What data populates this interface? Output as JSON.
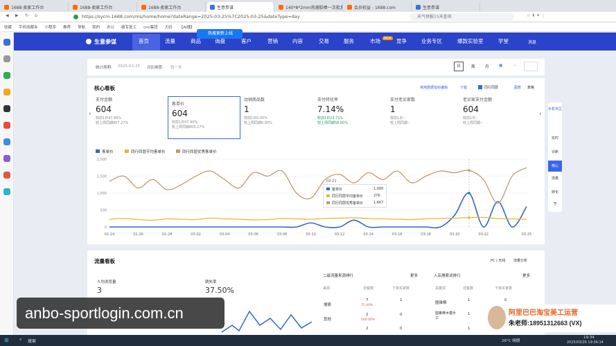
{
  "browser": {
    "tabs": [
      {
        "label": "1688-卖家工作台",
        "active": false
      },
      {
        "label": "1688-卖家工作台",
        "active": false
      },
      {
        "label": "1688-卖家工作台",
        "active": false
      },
      {
        "label": "生意参谋",
        "active": true
      },
      {
        "label": "140*8*2mm热熔胶棒一次批发",
        "active": false
      },
      {
        "label": "会员权益 - 1688.com",
        "active": false
      },
      {
        "label": "生意参谋",
        "active": false
      }
    ],
    "url": "https://sycm.1688.com/ms/home/home?dateRange=2025-03-25%7C2025-03-25&dateType=day",
    "search_placeholder": "天气预报15天查询",
    "bookmarks": [
      "收藏",
      "手机收藏夹",
      "小程序",
      "推荐",
      "导航",
      "我的",
      "办公",
      "破军复工",
      "cnc集团",
      "大码",
      "【AI播】"
    ]
  },
  "app": {
    "brand": "生意参谋",
    "hot_tag": "热搜更新上线",
    "nav": [
      "首页",
      "流量",
      "商品",
      "询盘",
      "客户",
      "营销",
      "内容",
      "交易",
      "服务",
      "市场",
      "竞争",
      "业务专区",
      "爆款实验室",
      "学堂",
      "消息"
    ],
    "market_badge": "NEW"
  },
  "period": {
    "stat_label": "统计周期:",
    "stat_value": "2025-03-25",
    "compare_label": "对比维度:",
    "compare_value": "较一天",
    "buttons": [
      "日",
      "周",
      "月"
    ]
  },
  "core": {
    "title": "核心看板",
    "links": [
      "常用数据指标编辑",
      "下载",
      "同行同层",
      "图表",
      "表格"
    ],
    "metrics": [
      {
        "label": "支付金额",
        "value": "604",
        "sub1": "较前1日47.90%",
        "sub2": "较上周同期807.27%"
      },
      {
        "label": "客单价",
        "value": "604",
        "sub1": "较前1日47.90%",
        "sub2": "较上周同期805.27%"
      },
      {
        "label": "动销商品数",
        "value": "1",
        "sub1": "较前1日0.00%",
        "sub2": "较上周同期0.00%"
      },
      {
        "label": "支付转化率",
        "value": "7.14%",
        "sub1": "较前1日23.71%",
        "sub2": "较上周同期58.00%"
      },
      {
        "label": "支付老买家数",
        "value": "1",
        "sub1": "较前1日--",
        "sub2": "较上周同期--"
      },
      {
        "label": "老买家支付金额",
        "value": "604",
        "sub1": "较前1日--",
        "sub2": "较上周同期--"
      }
    ],
    "legend": [
      "客单价",
      "同行同层平均客单价",
      "同行同层优秀客单价"
    ],
    "tooltip": {
      "date": "03-21",
      "rows": [
        {
          "name": "客单价",
          "value": "1,000"
        },
        {
          "name": "同行同层平均客单价",
          "value": "276"
        },
        {
          "name": "同行同层优秀客单价",
          "value": "1,667"
        }
      ]
    }
  },
  "chart_data": {
    "type": "line",
    "x": [
      "02-24",
      "02-25",
      "02-26",
      "02-27",
      "02-28",
      "03-01",
      "03-02",
      "03-03",
      "03-04",
      "03-05",
      "03-06",
      "03-07",
      "03-08",
      "03-09",
      "03-10",
      "03-11",
      "03-12",
      "03-13",
      "03-14",
      "03-15",
      "03-16",
      "03-17",
      "03-18",
      "03-19",
      "03-20",
      "03-21",
      "03-22",
      "03-23",
      "03-24",
      "03-25"
    ],
    "xticks": [
      "02-24",
      "02-26",
      "02-28",
      "03-02",
      "03-04",
      "03-06",
      "03-08",
      "03-10",
      "03-12",
      "03-14",
      "03-16",
      "03-18",
      "03-20",
      "03-22",
      "03-25"
    ],
    "yticks": [
      "0",
      "500",
      "1,000",
      "1,500",
      "2,000"
    ],
    "ylim": [
      0,
      2000
    ],
    "series": [
      {
        "name": "客单价",
        "color": "#2f66d0",
        "values": [
          0,
          0,
          0,
          0,
          0,
          0,
          0,
          0,
          0,
          0,
          0,
          0,
          0,
          0,
          120,
          0,
          0,
          200,
          0,
          0,
          0,
          0,
          0,
          0,
          350,
          1000,
          0,
          750,
          0,
          604
        ]
      },
      {
        "name": "同行同层平均客单价",
        "color": "#e8b730",
        "values": [
          230,
          250,
          220,
          200,
          240,
          230,
          220,
          260,
          240,
          230,
          210,
          220,
          250,
          240,
          230,
          250,
          260,
          270,
          250,
          240,
          230,
          220,
          240,
          250,
          260,
          276,
          280,
          250,
          240,
          230
        ]
      },
      {
        "name": "同行同层优秀客单价",
        "color": "#c49a6c",
        "values": [
          1350,
          1500,
          1150,
          1400,
          1100,
          1250,
          1500,
          1650,
          1400,
          1150,
          1600,
          1500,
          1650,
          1000,
          850,
          1400,
          1550,
          1300,
          1600,
          1400,
          1650,
          1300,
          1500,
          1650,
          1600,
          1667,
          1400,
          700,
          1500,
          1750
        ]
      }
    ]
  },
  "flow": {
    "title": "流量看板",
    "pc_label": "PC | 无线",
    "analysis_link": "流量分析",
    "visitors_label": "人均浏览量",
    "visitors_value": "3",
    "bounce_label": "跳失率",
    "bounce_value": "37.50%",
    "source_title": "二级流量来源排行",
    "more": "更多",
    "source_headers": [
      "来源",
      "访客数",
      "下单买家数"
    ],
    "source_rows": [
      {
        "name": "搜索",
        "visitors": "7",
        "change": "75.00%",
        "buyers": "1"
      },
      {
        "name": "其他",
        "visitors": "2",
        "change": "100.00%",
        "buyers": "0"
      },
      {
        "name": "",
        "visitors": "2",
        "change": "",
        "buyers": "0"
      }
    ],
    "keyword_title": "入店搜索词排行",
    "keyword_more": "更多",
    "keyword_headers": [
      "关键词",
      "访客数",
      "下单买家数"
    ],
    "keyword_rows": [
      {
        "name": "圆锥棒",
        "visitors": "1",
        "buyers": "0"
      },
      {
        "name": "圆锥棒木模手工",
        "visitors": "1",
        "buyers": "0"
      },
      {
        "name": "",
        "visitors": "1",
        "buyers": "0"
      }
    ]
  },
  "rightbar": [
    "手机专区",
    "实时",
    "诊断",
    "核心",
    "流量",
    "转化",
    "下"
  ],
  "watermark": "anbo-sportlogin.com.cn",
  "promo": {
    "line1": "阿里巴巴淘宝美工运营",
    "line2": "朱老师:18951312663 (VX)"
  },
  "taskbar": {
    "search": "搜索",
    "weather": "26°C 晴朗",
    "time": "19:34",
    "date": "2025/03/26 19:34:14"
  }
}
